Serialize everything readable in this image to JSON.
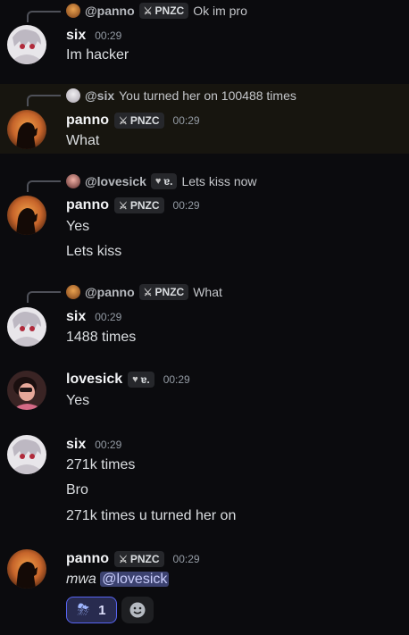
{
  "messages": [
    {
      "reply": {
        "user": "@panno",
        "tag": "PNZC",
        "text": "Ok im pro"
      },
      "author": "six",
      "time": "00:29",
      "lines": [
        "Im hacker"
      ]
    },
    {
      "reply": {
        "user": "@six",
        "text": "You turned her on 100488 times"
      },
      "author": "panno",
      "tag": "PNZC",
      "time": "00:29",
      "lines": [
        "What"
      ]
    },
    {
      "reply": {
        "user": "@lovesick",
        "tag": "ɐ.",
        "text": "Lets kiss now"
      },
      "author": "panno",
      "tag": "PNZC",
      "time": "00:29",
      "lines": [
        "Yes",
        "Lets kiss"
      ]
    },
    {
      "reply": {
        "user": "@panno",
        "tag": "PNZC",
        "text": "What"
      },
      "author": "six",
      "time": "00:29",
      "lines": [
        "1488 times"
      ]
    },
    {
      "author": "lovesick",
      "tag": "ɐ.",
      "time": "00:29",
      "lines": [
        "Yes"
      ]
    },
    {
      "author": "six",
      "time": "00:29",
      "lines": [
        "271k times",
        "Bro",
        "271k times u turned her on"
      ]
    },
    {
      "author": "panno",
      "tag": "PNZC",
      "time": "00:29",
      "italic": "mwa",
      "mention": "@lovesick",
      "reaction": {
        "emoji": "⛈",
        "count": "1"
      }
    }
  ],
  "colors": {
    "background": "#0b0b0e",
    "highlight": "#17150f",
    "mention_bg": "#3c4270",
    "reaction_border": "#5865f2"
  },
  "icons": {
    "tag_icon": "sword-icon",
    "heart_icon": "heart-icon",
    "add_reaction_icon": "smiley-icon"
  }
}
